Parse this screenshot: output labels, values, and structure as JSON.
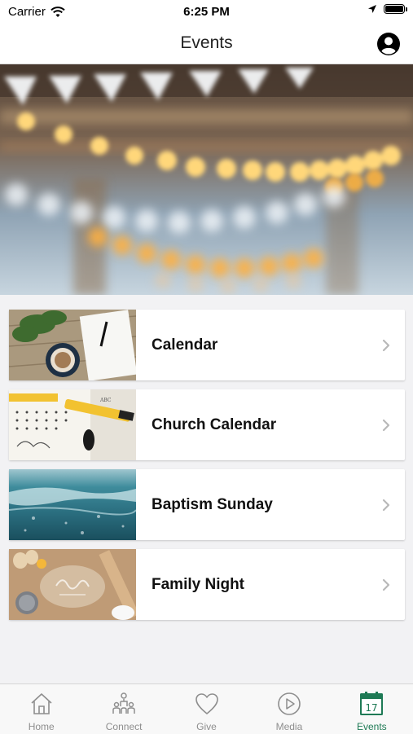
{
  "status_bar": {
    "carrier": "Carrier",
    "time": "6:25 PM"
  },
  "nav": {
    "title": "Events"
  },
  "events": [
    {
      "label": "Calendar"
    },
    {
      "label": "Church Calendar"
    },
    {
      "label": "Baptism Sunday"
    },
    {
      "label": "Family Night"
    }
  ],
  "tabs": [
    {
      "label": "Home",
      "icon": "home-icon"
    },
    {
      "label": "Connect",
      "icon": "connect-icon"
    },
    {
      "label": "Give",
      "icon": "heart-icon"
    },
    {
      "label": "Media",
      "icon": "play-icon"
    },
    {
      "label": "Events",
      "icon": "calendar-icon",
      "badge": "17",
      "active": true
    }
  ],
  "colors": {
    "accent": "#1e7a55",
    "inactive": "#8e8e8e"
  }
}
